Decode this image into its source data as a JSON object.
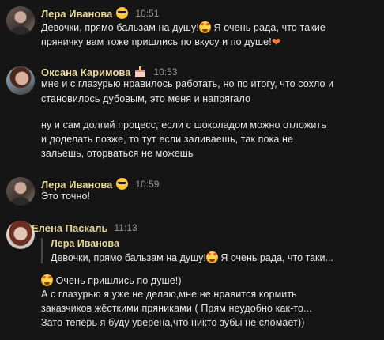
{
  "messages": [
    {
      "author": "Лера Иванова",
      "badge_icon": "sunglasses-emoji",
      "time": "10:51",
      "lines": [
        "Девочки, прямо бальзам на душу!",
        " Я очень рада, что такие",
        "пряничку вам тоже пришлись по вкусу и по душе!"
      ]
    },
    {
      "author": "Оксана Каримова",
      "badge_icon": "cake-emoji",
      "time": "10:53",
      "lines": [
        "мне и с глазурью нравилось работать, но по итогу, что сохло и",
        "становилось дубовым, это меня и напрягало",
        "ну и сам долгий процесс, если с шоколадом можно отложить",
        "и доделать позже, то тут если заливаешь, так пока не",
        "зальешь, оторваться не можешь"
      ]
    },
    {
      "author": "Лера Иванова",
      "badge_icon": "sunglasses-emoji",
      "time": "10:59",
      "lines": [
        "Это точно!"
      ]
    },
    {
      "author": "Елена Паскаль",
      "time": "11:13",
      "quote": {
        "author": "Лера Иванова",
        "text_a": "Девочки, прямо бальзам на душу!",
        "text_b": " Я очень рада, что таки..."
      },
      "lines": [
        " Очень пришлись по душе!)",
        "А с глазурью я уже не делаю,мне не нравится кормить",
        "заказчиков жёсткими пряниками ( Прям неудобно как-то...",
        "Зато теперь я буду уверена,что никто зубы не сломает))"
      ]
    }
  ]
}
